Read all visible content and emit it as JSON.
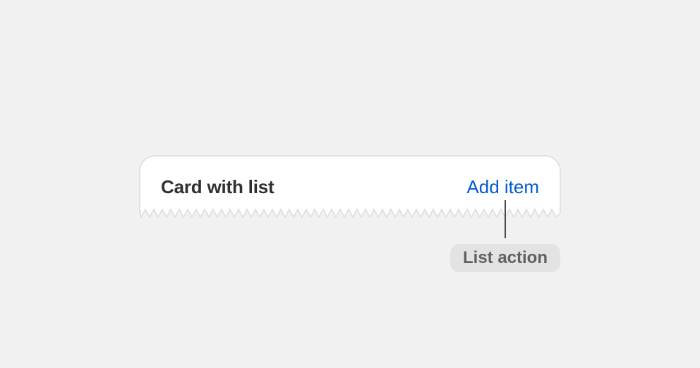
{
  "card": {
    "title": "Card with list",
    "action_label": "Add item"
  },
  "callout": {
    "label": "List action"
  },
  "colors": {
    "background": "#f1f1f1",
    "card_surface": "#ffffff",
    "card_border": "#dcdcdc",
    "title_text": "#303030",
    "action_link": "#005bd3",
    "callout_line": "#4a4a4a",
    "callout_badge_bg": "#e3e3e3",
    "callout_badge_text": "#616161"
  }
}
